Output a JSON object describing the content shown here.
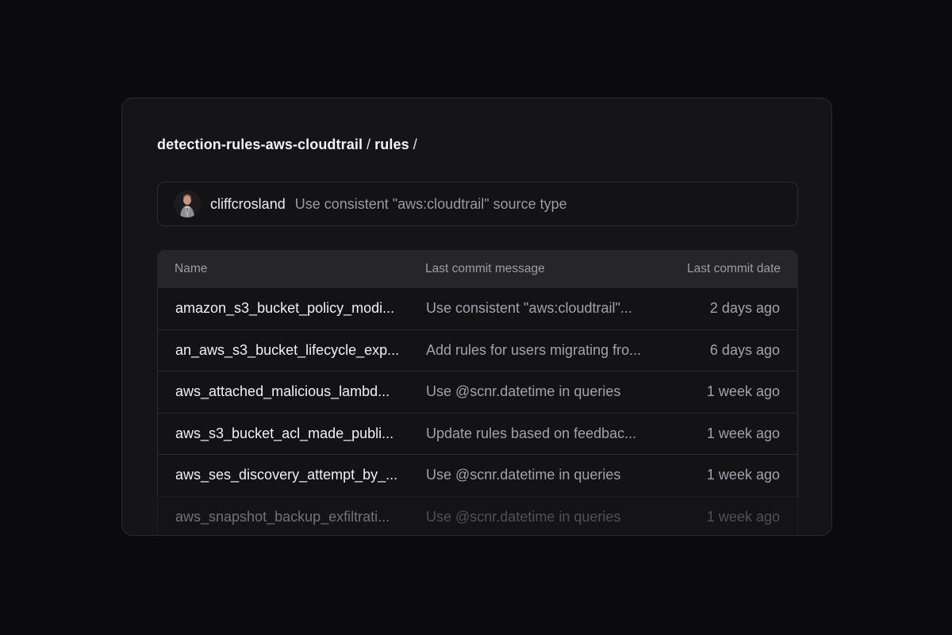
{
  "breadcrumb": {
    "repo": "detection-rules-aws-cloudtrail",
    "folder": "rules"
  },
  "latest_commit": {
    "author": "cliffcrosland",
    "message": "Use consistent \"aws:cloudtrail\" source type"
  },
  "table": {
    "headers": {
      "name": "Name",
      "message": "Last commit message",
      "date": "Last commit date"
    },
    "rows": [
      {
        "name": "amazon_s3_bucket_policy_modi...",
        "message": "Use consistent \"aws:cloudtrail\"...",
        "date": "2 days ago"
      },
      {
        "name": "an_aws_s3_bucket_lifecycle_exp...",
        "message": "Add rules for users migrating fro...",
        "date": "6 days ago"
      },
      {
        "name": "aws_attached_malicious_lambd...",
        "message": "Use @scnr.datetime in queries",
        "date": "1 week ago"
      },
      {
        "name": "aws_s3_bucket_acl_made_publi...",
        "message": " Update rules based on feedbac...",
        "date": "1 week ago"
      },
      {
        "name": "aws_ses_discovery_attempt_by_...",
        "message": "Use @scnr.datetime in queries",
        "date": "1 week ago"
      },
      {
        "name": "aws_snapshot_backup_exfiltrati...",
        "message": "Use @scnr.datetime in queries",
        "date": "1 week ago"
      }
    ]
  }
}
